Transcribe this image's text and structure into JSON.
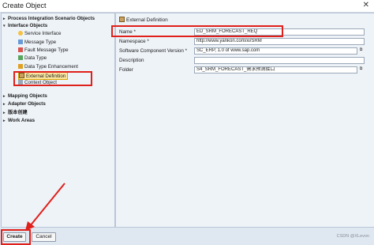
{
  "window": {
    "title": "Create Object",
    "close_glyph": "✕"
  },
  "tree": {
    "items": [
      {
        "label": "Process Integration Scenario Objects",
        "caret": "▸",
        "bold": true,
        "icon": ""
      },
      {
        "label": "Interface Objects",
        "caret": "▾",
        "bold": true,
        "icon": ""
      },
      {
        "label": "Service Interface",
        "caret": "",
        "bold": false,
        "icon": "service-interface-icon"
      },
      {
        "label": "Message Type",
        "caret": "",
        "bold": false,
        "icon": "message-type-icon"
      },
      {
        "label": "Fault Message Type",
        "caret": "",
        "bold": false,
        "icon": "fault-message-type-icon"
      },
      {
        "label": "Data Type",
        "caret": "",
        "bold": false,
        "icon": "data-type-icon"
      },
      {
        "label": "Data Type Enhancement",
        "caret": "",
        "bold": false,
        "icon": "data-type-enhancement-icon"
      },
      {
        "label": "External Definition",
        "caret": "",
        "bold": false,
        "icon": "external-definition-icon",
        "selected": true
      },
      {
        "label": "Context Object",
        "caret": "",
        "bold": false,
        "icon": "context-object-icon"
      },
      {
        "label": "Mapping Objects",
        "caret": "▸",
        "bold": true,
        "icon": ""
      },
      {
        "label": "Adapter Objects",
        "caret": "▸",
        "bold": true,
        "icon": ""
      },
      {
        "label": "版本创建",
        "caret": "▸",
        "bold": true,
        "icon": ""
      },
      {
        "label": "Work Areas",
        "caret": "▸",
        "bold": true,
        "icon": ""
      }
    ]
  },
  "form": {
    "header": "External Definition",
    "name": {
      "label": "Name *",
      "value": "ED_SRM_FORECAST_REQ"
    },
    "namespace": {
      "label": "Namespace *",
      "value": "http://www.yankon.com/xi/SRM"
    },
    "swcv": {
      "label": "Software Component Version *",
      "value": "SC_ERP, 1.0 of www.sap.com"
    },
    "description": {
      "label": "Description",
      "value": ""
    },
    "folder": {
      "label": "Folder",
      "value": "S4_SRM_FORECAST_需求预测接口"
    }
  },
  "buttons": {
    "create": "Create",
    "cancel": "Cancel"
  },
  "watermark": "CSDN @XLevon",
  "colors": {
    "highlight_red": "#e0201a"
  }
}
